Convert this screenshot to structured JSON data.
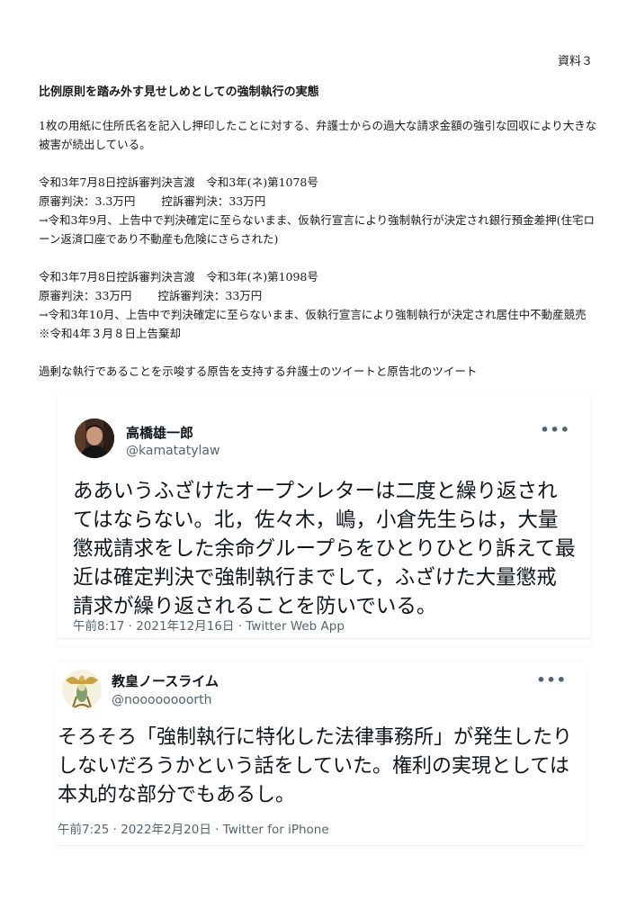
{
  "document": {
    "reference": "資料３",
    "heading": "比例原則を踏み外す見せしめとしての強制執行の実態",
    "intro": "1枚の用紙に住所氏名を記入し押印したことに対する、弁護士からの過大な請求金額の強引な回収により大きな被害が続出している。",
    "case1": {
      "line1": "令和3年7月8日控訴審判決言渡　令和3年(ネ)第1078号",
      "line2": "原審判決：3.3万円　　 控訴審判決：33万円",
      "line3": "→令和3年9月、上告中で判決確定に至らないまま、仮執行宣言により強制執行が決定され銀行預金差押(住宅ローン返済口座であり不動産も危険にさらされた)"
    },
    "case2": {
      "line1": "令和3年7月8日控訴審判決言渡　令和3年(ネ)第1098号",
      "line2": "原審判決：33万円　　 控訴審判決：33万円",
      "line3": "→令和3年10月、上告中で判決確定に至らないまま、仮執行宣言により強制執行が決定され居住中不動産競売　※令和4年３月８日上告棄却"
    },
    "caption": "過剰な執行であることを示唆する原告を支持する弁護士のツイートと原告北のツイート"
  },
  "tweets": [
    {
      "name": "高橋雄一郎",
      "handle": "@kamatatylaw",
      "more": "•••",
      "text": "ああいうふざけたオープンレターは二度と繰り返されてはならない。北，佐々木，嶋，小倉先生らは，大量懲戒請求をした余命グループらをひとりひとり訴えて最近は確定判決で強制執行までして，ふざけた大量懲戒請求が繰り返されることを防いでいる。",
      "meta": "午前8:17 · 2021年12月16日 · Twitter Web App"
    },
    {
      "name": "教皇ノースライム",
      "handle": "@noooooooorth",
      "more": "•••",
      "text": "そろそろ「強制執行に特化した法律事務所」が発生したりしないだろうかという話をしていた。権利の実現としては本丸的な部分でもあるし。",
      "meta": "午前7:25 · 2022年2月20日 · Twitter for iPhone"
    }
  ]
}
